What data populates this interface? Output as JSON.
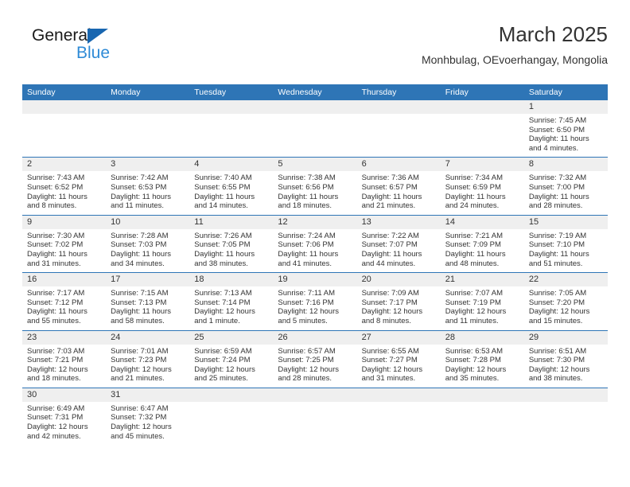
{
  "logo": {
    "primary_text": "General",
    "secondary_text": "Blue",
    "primary_color": "#1a1a1a",
    "secondary_color": "#2e8ad6",
    "triangle_color": "#1866b0"
  },
  "header": {
    "title": "March 2025",
    "subtitle": "Monhbulag, OEvoerhangay, Mongolia"
  },
  "theme": {
    "header_blue": "#2e75b6",
    "day_band_gray": "#efefef",
    "text_color": "#333333"
  },
  "labels": {
    "sunrise_prefix": "Sunrise:",
    "sunset_prefix": "Sunset:",
    "daylight_prefix": "Daylight:"
  },
  "weekdays": [
    "Sunday",
    "Monday",
    "Tuesday",
    "Wednesday",
    "Thursday",
    "Friday",
    "Saturday"
  ],
  "weeks": [
    [
      {
        "day": "",
        "empty": true
      },
      {
        "day": "",
        "empty": true
      },
      {
        "day": "",
        "empty": true
      },
      {
        "day": "",
        "empty": true
      },
      {
        "day": "",
        "empty": true
      },
      {
        "day": "",
        "empty": true
      },
      {
        "day": "1",
        "sunrise": "Sunrise: 7:45 AM",
        "sunset": "Sunset: 6:50 PM",
        "daylight_line1": "Daylight: 11 hours",
        "daylight_line2": "and 4 minutes."
      }
    ],
    [
      {
        "day": "2",
        "sunrise": "Sunrise: 7:43 AM",
        "sunset": "Sunset: 6:52 PM",
        "daylight_line1": "Daylight: 11 hours",
        "daylight_line2": "and 8 minutes."
      },
      {
        "day": "3",
        "sunrise": "Sunrise: 7:42 AM",
        "sunset": "Sunset: 6:53 PM",
        "daylight_line1": "Daylight: 11 hours",
        "daylight_line2": "and 11 minutes."
      },
      {
        "day": "4",
        "sunrise": "Sunrise: 7:40 AM",
        "sunset": "Sunset: 6:55 PM",
        "daylight_line1": "Daylight: 11 hours",
        "daylight_line2": "and 14 minutes."
      },
      {
        "day": "5",
        "sunrise": "Sunrise: 7:38 AM",
        "sunset": "Sunset: 6:56 PM",
        "daylight_line1": "Daylight: 11 hours",
        "daylight_line2": "and 18 minutes."
      },
      {
        "day": "6",
        "sunrise": "Sunrise: 7:36 AM",
        "sunset": "Sunset: 6:57 PM",
        "daylight_line1": "Daylight: 11 hours",
        "daylight_line2": "and 21 minutes."
      },
      {
        "day": "7",
        "sunrise": "Sunrise: 7:34 AM",
        "sunset": "Sunset: 6:59 PM",
        "daylight_line1": "Daylight: 11 hours",
        "daylight_line2": "and 24 minutes."
      },
      {
        "day": "8",
        "sunrise": "Sunrise: 7:32 AM",
        "sunset": "Sunset: 7:00 PM",
        "daylight_line1": "Daylight: 11 hours",
        "daylight_line2": "and 28 minutes."
      }
    ],
    [
      {
        "day": "9",
        "sunrise": "Sunrise: 7:30 AM",
        "sunset": "Sunset: 7:02 PM",
        "daylight_line1": "Daylight: 11 hours",
        "daylight_line2": "and 31 minutes."
      },
      {
        "day": "10",
        "sunrise": "Sunrise: 7:28 AM",
        "sunset": "Sunset: 7:03 PM",
        "daylight_line1": "Daylight: 11 hours",
        "daylight_line2": "and 34 minutes."
      },
      {
        "day": "11",
        "sunrise": "Sunrise: 7:26 AM",
        "sunset": "Sunset: 7:05 PM",
        "daylight_line1": "Daylight: 11 hours",
        "daylight_line2": "and 38 minutes."
      },
      {
        "day": "12",
        "sunrise": "Sunrise: 7:24 AM",
        "sunset": "Sunset: 7:06 PM",
        "daylight_line1": "Daylight: 11 hours",
        "daylight_line2": "and 41 minutes."
      },
      {
        "day": "13",
        "sunrise": "Sunrise: 7:22 AM",
        "sunset": "Sunset: 7:07 PM",
        "daylight_line1": "Daylight: 11 hours",
        "daylight_line2": "and 44 minutes."
      },
      {
        "day": "14",
        "sunrise": "Sunrise: 7:21 AM",
        "sunset": "Sunset: 7:09 PM",
        "daylight_line1": "Daylight: 11 hours",
        "daylight_line2": "and 48 minutes."
      },
      {
        "day": "15",
        "sunrise": "Sunrise: 7:19 AM",
        "sunset": "Sunset: 7:10 PM",
        "daylight_line1": "Daylight: 11 hours",
        "daylight_line2": "and 51 minutes."
      }
    ],
    [
      {
        "day": "16",
        "sunrise": "Sunrise: 7:17 AM",
        "sunset": "Sunset: 7:12 PM",
        "daylight_line1": "Daylight: 11 hours",
        "daylight_line2": "and 55 minutes."
      },
      {
        "day": "17",
        "sunrise": "Sunrise: 7:15 AM",
        "sunset": "Sunset: 7:13 PM",
        "daylight_line1": "Daylight: 11 hours",
        "daylight_line2": "and 58 minutes."
      },
      {
        "day": "18",
        "sunrise": "Sunrise: 7:13 AM",
        "sunset": "Sunset: 7:14 PM",
        "daylight_line1": "Daylight: 12 hours",
        "daylight_line2": "and 1 minute."
      },
      {
        "day": "19",
        "sunrise": "Sunrise: 7:11 AM",
        "sunset": "Sunset: 7:16 PM",
        "daylight_line1": "Daylight: 12 hours",
        "daylight_line2": "and 5 minutes."
      },
      {
        "day": "20",
        "sunrise": "Sunrise: 7:09 AM",
        "sunset": "Sunset: 7:17 PM",
        "daylight_line1": "Daylight: 12 hours",
        "daylight_line2": "and 8 minutes."
      },
      {
        "day": "21",
        "sunrise": "Sunrise: 7:07 AM",
        "sunset": "Sunset: 7:19 PM",
        "daylight_line1": "Daylight: 12 hours",
        "daylight_line2": "and 11 minutes."
      },
      {
        "day": "22",
        "sunrise": "Sunrise: 7:05 AM",
        "sunset": "Sunset: 7:20 PM",
        "daylight_line1": "Daylight: 12 hours",
        "daylight_line2": "and 15 minutes."
      }
    ],
    [
      {
        "day": "23",
        "sunrise": "Sunrise: 7:03 AM",
        "sunset": "Sunset: 7:21 PM",
        "daylight_line1": "Daylight: 12 hours",
        "daylight_line2": "and 18 minutes."
      },
      {
        "day": "24",
        "sunrise": "Sunrise: 7:01 AM",
        "sunset": "Sunset: 7:23 PM",
        "daylight_line1": "Daylight: 12 hours",
        "daylight_line2": "and 21 minutes."
      },
      {
        "day": "25",
        "sunrise": "Sunrise: 6:59 AM",
        "sunset": "Sunset: 7:24 PM",
        "daylight_line1": "Daylight: 12 hours",
        "daylight_line2": "and 25 minutes."
      },
      {
        "day": "26",
        "sunrise": "Sunrise: 6:57 AM",
        "sunset": "Sunset: 7:25 PM",
        "daylight_line1": "Daylight: 12 hours",
        "daylight_line2": "and 28 minutes."
      },
      {
        "day": "27",
        "sunrise": "Sunrise: 6:55 AM",
        "sunset": "Sunset: 7:27 PM",
        "daylight_line1": "Daylight: 12 hours",
        "daylight_line2": "and 31 minutes."
      },
      {
        "day": "28",
        "sunrise": "Sunrise: 6:53 AM",
        "sunset": "Sunset: 7:28 PM",
        "daylight_line1": "Daylight: 12 hours",
        "daylight_line2": "and 35 minutes."
      },
      {
        "day": "29",
        "sunrise": "Sunrise: 6:51 AM",
        "sunset": "Sunset: 7:30 PM",
        "daylight_line1": "Daylight: 12 hours",
        "daylight_line2": "and 38 minutes."
      }
    ],
    [
      {
        "day": "30",
        "sunrise": "Sunrise: 6:49 AM",
        "sunset": "Sunset: 7:31 PM",
        "daylight_line1": "Daylight: 12 hours",
        "daylight_line2": "and 42 minutes."
      },
      {
        "day": "31",
        "sunrise": "Sunrise: 6:47 AM",
        "sunset": "Sunset: 7:32 PM",
        "daylight_line1": "Daylight: 12 hours",
        "daylight_line2": "and 45 minutes."
      },
      {
        "day": "",
        "empty": true
      },
      {
        "day": "",
        "empty": true
      },
      {
        "day": "",
        "empty": true
      },
      {
        "day": "",
        "empty": true
      },
      {
        "day": "",
        "empty": true
      }
    ]
  ]
}
